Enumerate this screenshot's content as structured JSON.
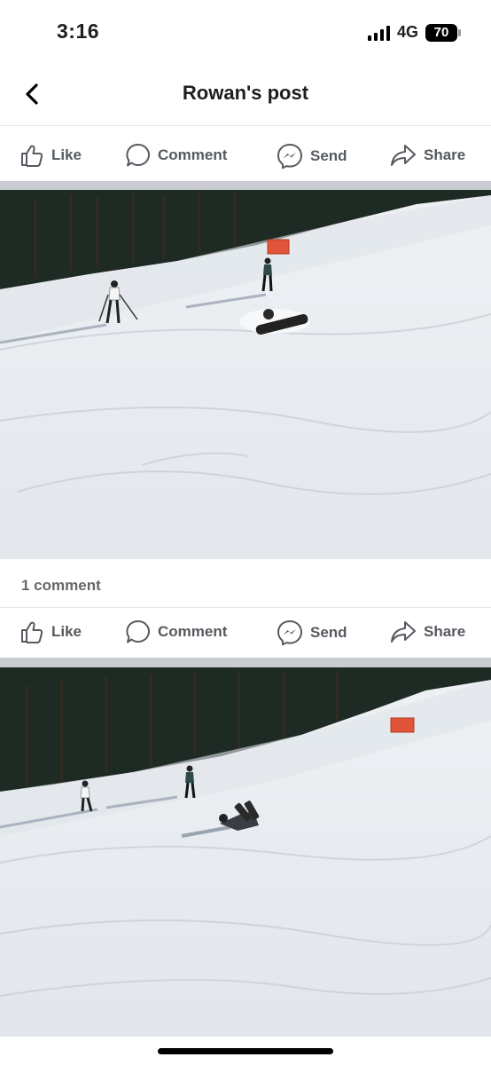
{
  "status_bar": {
    "time": "3:16",
    "network": "4G",
    "battery": "70"
  },
  "header": {
    "title": "Rowan's post",
    "back_icon": "chevron-left-icon"
  },
  "post_1": {
    "actions": {
      "like": "Like",
      "comment": "Comment",
      "send": "Send",
      "share": "Share"
    },
    "photo": "ski-slope-photo-1",
    "comment_count": "1 comment"
  },
  "post_2": {
    "actions": {
      "like": "Like",
      "comment": "Comment",
      "send": "Send",
      "share": "Share"
    },
    "photo": "ski-slope-photo-2"
  },
  "colors": {
    "action_text": "#555a60",
    "snow": "#f1f3f6",
    "trees": "#1e2a24",
    "flag": "#e0553a"
  }
}
